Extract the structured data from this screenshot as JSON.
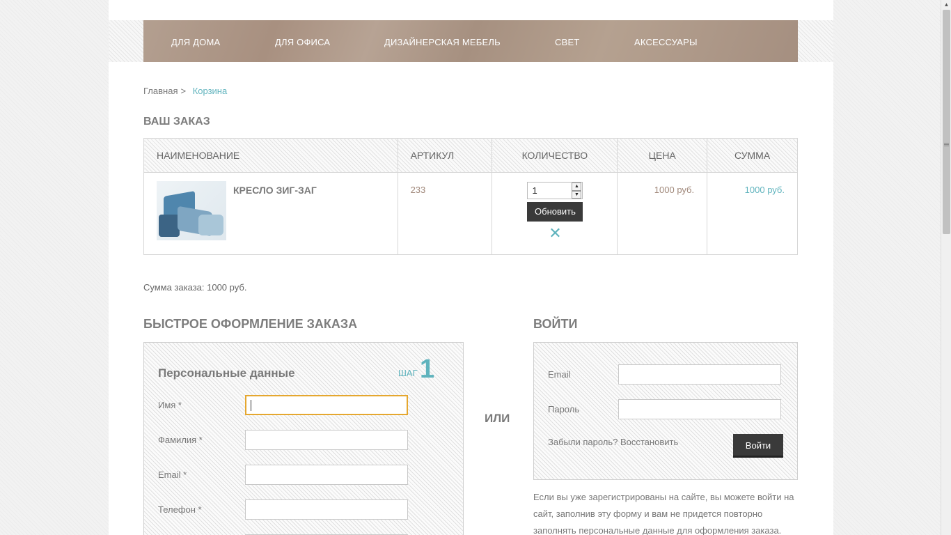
{
  "nav": {
    "items": [
      {
        "label": "Для дома"
      },
      {
        "label": "Для офиса"
      },
      {
        "label": "Дизайнерская мебель"
      },
      {
        "label": "Свет"
      },
      {
        "label": "Аксессуары"
      }
    ]
  },
  "breadcrumb": {
    "home": "Главная",
    "separator": ">",
    "current": "Корзина"
  },
  "order": {
    "title": "Ваш заказ",
    "columns": {
      "name": "Наименование",
      "sku": "Артикул",
      "qty": "Количество",
      "price": "Цена",
      "sum": "Сумма"
    },
    "rows": [
      {
        "name": "Кресло Зиг-Заг",
        "sku": "233",
        "qty": "1",
        "update_label": "Обновить",
        "remove_glyph": "✕",
        "price": "1000 руб.",
        "sum": "1000 руб."
      }
    ],
    "total_text": "Сумма заказа: 1000 руб."
  },
  "quick_order": {
    "title": "Быстрое оформление заказа",
    "box_title": "Персональные данные",
    "step_word": "шаг",
    "step_number": "1",
    "fields": {
      "first_name": {
        "label": "Имя *",
        "value": ""
      },
      "last_name": {
        "label": "Фамилия *",
        "value": ""
      },
      "email": {
        "label": "Email *",
        "value": ""
      },
      "phone": {
        "label": "Телефон *",
        "value": ""
      }
    }
  },
  "or_label": "ИЛИ",
  "login": {
    "title": "Войти",
    "email_label": "Email",
    "password_label": "Пароль",
    "forgot_text": "Забыли пароль? Восстановить",
    "submit_label": "Войти",
    "note": "Если вы уже зарегистрированы на сайте, вы можете войти на сайт, заполнив эту форму и вам не придется повторно заполнять персональные данные для оформления заказа."
  },
  "colors": {
    "accent": "#5fb3bd",
    "nav_bg": "#a89080",
    "price": "#a0887a",
    "button_dark": "#3a3a3a",
    "focus": "#e5a72f"
  }
}
